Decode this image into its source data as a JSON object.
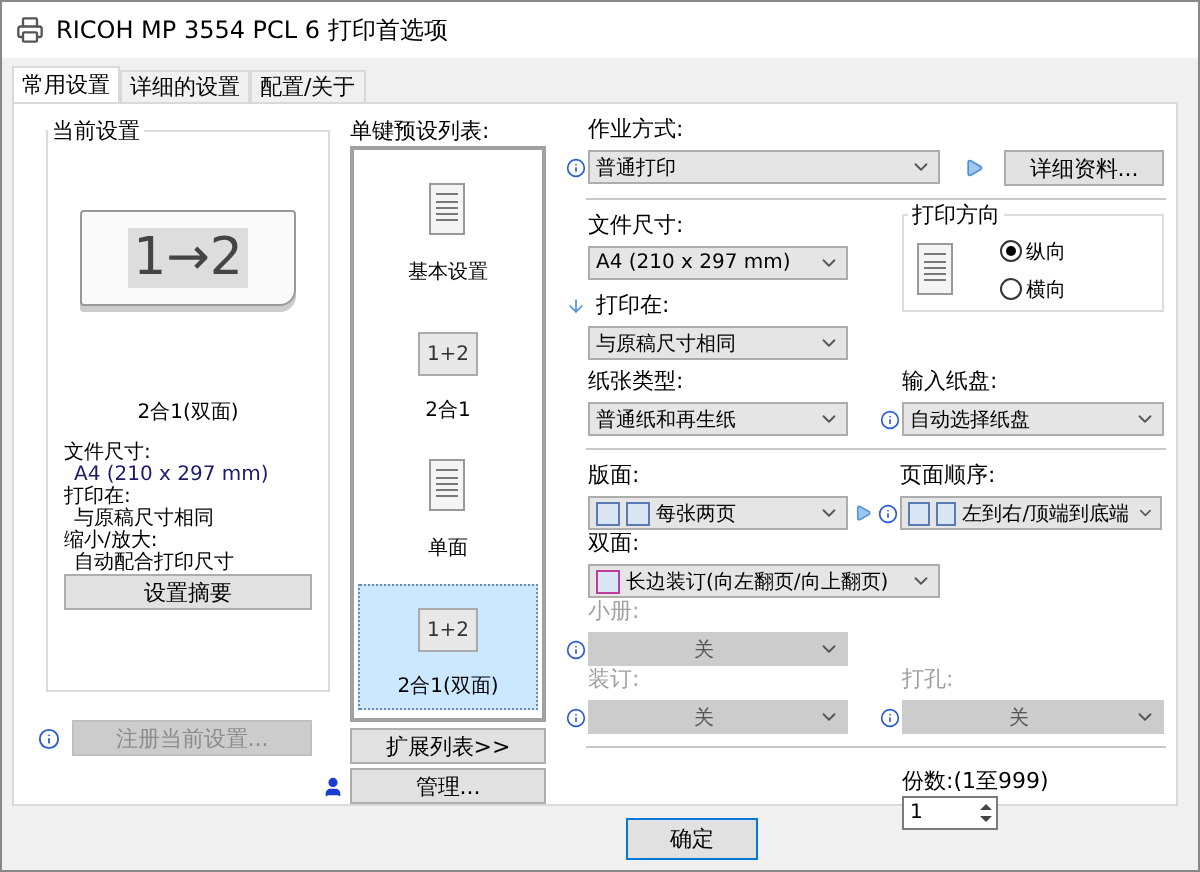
{
  "window": {
    "title": "RICOH MP 3554 PCL 6 打印首选项"
  },
  "tabs": [
    {
      "label": "常用设置",
      "selected": true
    },
    {
      "label": "详细的设置",
      "selected": false
    },
    {
      "label": "配置/关于",
      "selected": false
    }
  ],
  "current_settings": {
    "title": "当前设置",
    "preview": "1→2",
    "caption": "2合1(双面)",
    "details": [
      {
        "kind": "label",
        "text": "文件尺寸:"
      },
      {
        "kind": "value",
        "text": "A4 (210 x 297 mm)"
      },
      {
        "kind": "label",
        "text": "打印在:"
      },
      {
        "kind": "value",
        "text": "与原稿尺寸相同"
      },
      {
        "kind": "label",
        "text": "缩小/放大:"
      },
      {
        "kind": "value",
        "text": "自动配合打印尺寸"
      }
    ],
    "summary_button": "设置摘要"
  },
  "register_button": {
    "label": "注册当前设置...",
    "disabled": true
  },
  "presets": {
    "title": "单键预设列表:",
    "items": [
      {
        "label": "基本设置",
        "kind": "document",
        "selected": false
      },
      {
        "label": "2合1",
        "kind": "combine",
        "preview": "1+2",
        "selected": false
      },
      {
        "label": "单面",
        "kind": "document",
        "selected": false
      },
      {
        "label": "2合1(双面)",
        "kind": "combine",
        "preview": "1+2",
        "selected": true
      }
    ],
    "expand_button": "扩展列表>>",
    "manage_button": "管理..."
  },
  "job": {
    "label": "作业方式:",
    "value": "普通打印",
    "info": true
  },
  "details_button": "详细资料...",
  "paper_size": {
    "label": "文件尺寸:",
    "value": "A4 (210 x 297 mm)"
  },
  "print_on": {
    "label": "打印在:",
    "value": "与原稿尺寸相同"
  },
  "orientation": {
    "title": "打印方向",
    "options": [
      {
        "label": "纵向",
        "selected": true
      },
      {
        "label": "横向",
        "selected": false
      }
    ]
  },
  "paper_type": {
    "label": "纸张类型:",
    "value": "普通纸和再生纸"
  },
  "input_tray": {
    "label": "输入纸盘:",
    "value": "自动选择纸盘",
    "info": true
  },
  "layout": {
    "label": "版面:",
    "value": "每张两页"
  },
  "page_order": {
    "label": "页面顺序:",
    "value": "左到右/顶端到底端",
    "info": true
  },
  "duplex": {
    "label": "双面:",
    "value": "长边装订(向左翻页/向上翻页)"
  },
  "booklet": {
    "label": "小册:",
    "value": "关",
    "info": true,
    "disabled": true
  },
  "staple": {
    "label": "装订:",
    "value": "关",
    "info": true,
    "disabled": true
  },
  "punch": {
    "label": "打孔:",
    "value": "关",
    "info": true,
    "disabled": true
  },
  "copies": {
    "label": "份数:(1至999)",
    "value": "1"
  },
  "ok_button": "确定"
}
